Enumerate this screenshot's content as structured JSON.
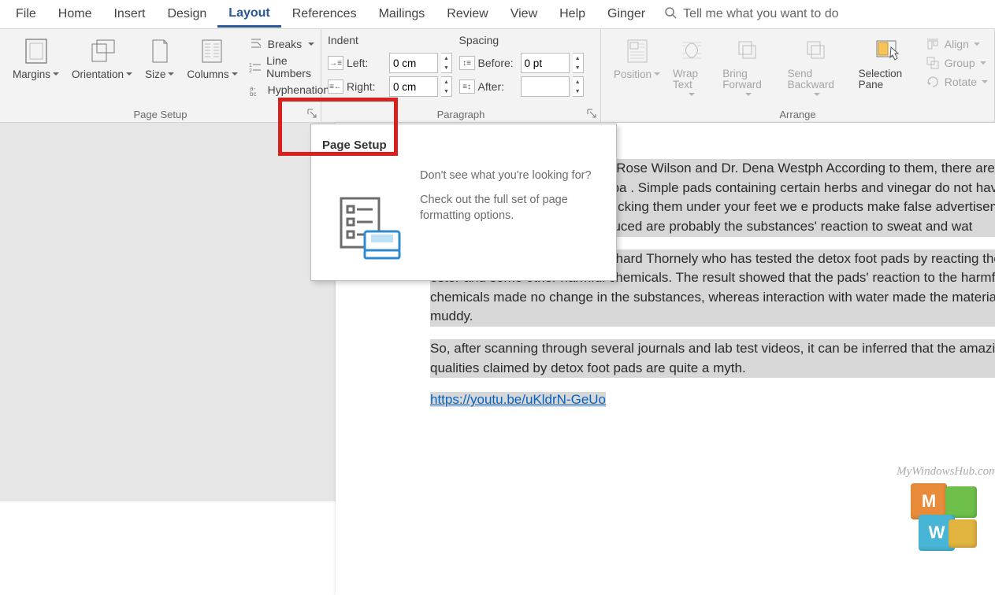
{
  "tabs": [
    "File",
    "Home",
    "Insert",
    "Design",
    "Layout",
    "References",
    "Mailings",
    "Review",
    "View",
    "Help",
    "Ginger"
  ],
  "active_tab": "Layout",
  "tell_me": {
    "placeholder": "Tell me what you want to do"
  },
  "ribbon": {
    "page_setup": {
      "label": "Page Setup",
      "margins": "Margins",
      "orientation": "Orientation",
      "size": "Size",
      "columns": "Columns",
      "breaks": "Breaks",
      "line_numbers": "Line Numbers",
      "hyphenation": "Hyphenation"
    },
    "paragraph": {
      "label": "Paragraph",
      "indent_label": "Indent",
      "spacing_label": "Spacing",
      "left_label": "Left:",
      "right_label": "Right:",
      "before_label": "Before:",
      "after_label": "After:",
      "left_value": "0 cm",
      "right_value": "0 cm",
      "before_value": "0 pt",
      "after_value": ""
    },
    "arrange": {
      "label": "Arrange",
      "position": "Position",
      "wrap_text": "Wrap Text",
      "bring_forward": "Bring Forward",
      "send_backward": "Send Backward",
      "selection_pane": "Selection Pane",
      "align": "Align",
      "group": "Group",
      "rotate": "Rotate"
    }
  },
  "tooltip": {
    "title": "Page Setup",
    "desc1": "Don't see what you're looking for?",
    "desc2": "Check out the full set of page formatting options."
  },
  "document": {
    "p1": "y Healthline, doctors Dr. Debra Rose Wilson and Dr. Dena Westph According to them, there are no bodily responses to detox foot pa . Simple pads containing certain herbs and vinegar do not have t ne body overnight. Even though sticking them under your feet we e products make false advertisements and do not work the way t produced are probably the substances' reaction to sweat and wat",
    "p2": "You can check the video by Richard Thornely who has tested the detox foot pads by reacting the water, ester and some other harmful chemicals. The result showed that the pads' reaction to the harmful chemicals made no change in the substances, whereas interaction with water made the material muddy.",
    "p3": "So, after scanning through several journals and lab test videos, it can be inferred that the amazin qualities claimed by detox foot pads are quite a myth.",
    "link": "https://youtu.be/uKldrN-GeUo"
  },
  "watermark": {
    "text": "MyWindowsHub.com",
    "m": "M",
    "w": "W"
  }
}
